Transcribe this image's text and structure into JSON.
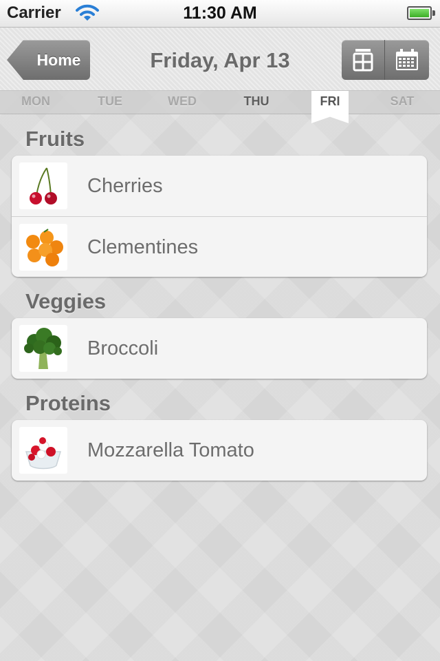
{
  "status_bar": {
    "carrier": "Carrier",
    "time": "11:30 AM"
  },
  "nav": {
    "back_label": "Home",
    "title": "Friday, Apr 13"
  },
  "days": [
    "MON",
    "TUE",
    "WED",
    "THU",
    "FRI",
    "SAT"
  ],
  "selected_day": "FRI",
  "sections": {
    "fruits": {
      "title": "Fruits",
      "items": [
        "Cherries",
        "Clementines"
      ]
    },
    "veggies": {
      "title": "Veggies",
      "items": [
        "Broccoli"
      ]
    },
    "proteins": {
      "title": "Proteins",
      "items": [
        "Mozzarella Tomato"
      ]
    }
  },
  "icons": {
    "back": "chevron-left-icon",
    "grid_view": "grid-view-icon",
    "calendar": "calendar-icon",
    "wifi": "wifi-icon",
    "battery": "battery-icon"
  },
  "colors": {
    "nav_button": "#808080",
    "section_header": "#6a6a6a",
    "row_text": "#6d6d6d",
    "battery": "#4cc232"
  }
}
